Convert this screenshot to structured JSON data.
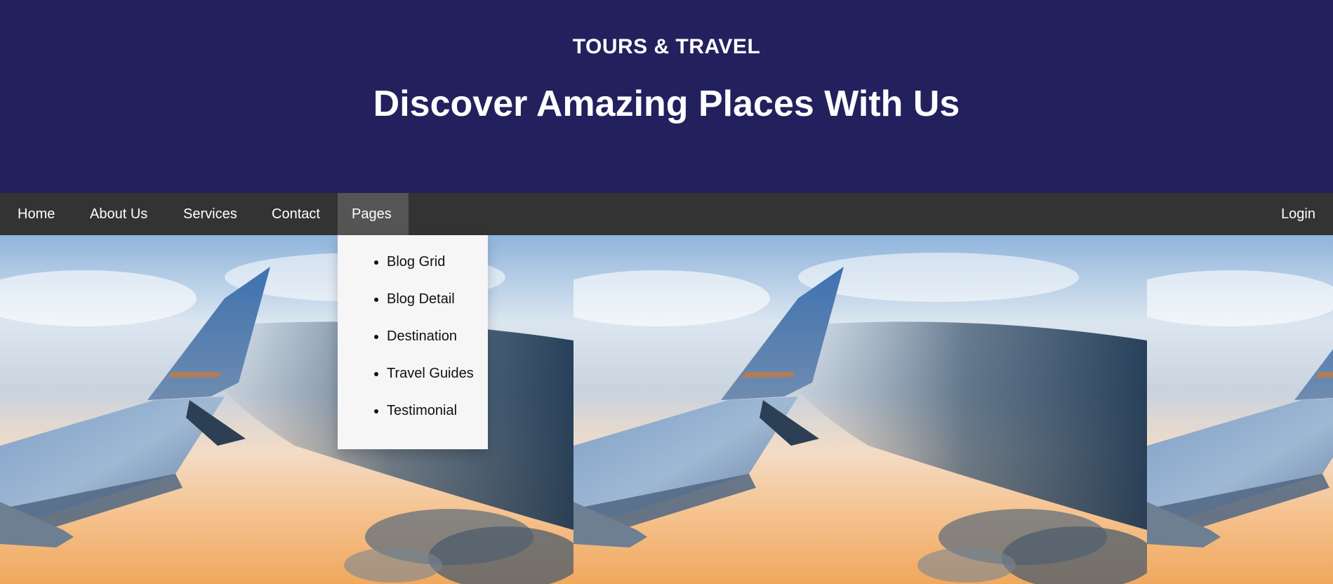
{
  "header": {
    "brand": "TOURS & TRAVEL",
    "headline": "Discover Amazing Places With Us",
    "background_color": "#23205e"
  },
  "nav": {
    "background_color": "#333333",
    "items": [
      {
        "label": "Home"
      },
      {
        "label": "About Us"
      },
      {
        "label": "Services"
      },
      {
        "label": "Contact"
      },
      {
        "label": "Pages",
        "active": true
      }
    ],
    "login_label": "Login"
  },
  "dropdown": {
    "items": [
      {
        "label": "Blog Grid"
      },
      {
        "label": "Blog Detail"
      },
      {
        "label": "Destination"
      },
      {
        "label": "Travel Guides"
      },
      {
        "label": "Testimonial"
      }
    ]
  },
  "hero": {
    "image_description_icon": "airplane-wing-sky-image"
  }
}
